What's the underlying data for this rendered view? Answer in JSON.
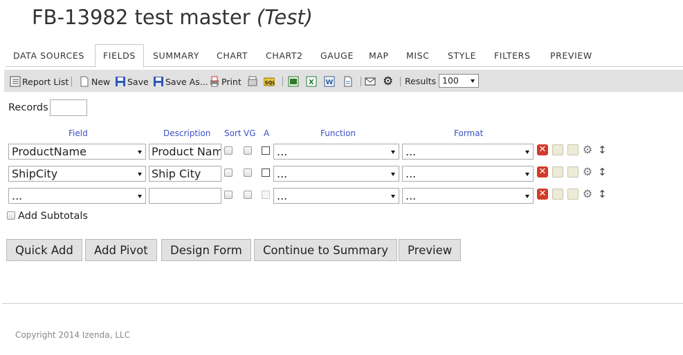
{
  "header": {
    "title": "FB-13982 test master",
    "env": "(Test)"
  },
  "tabs": [
    {
      "label": "DATA SOURCES",
      "active": false
    },
    {
      "label": "FIELDS",
      "active": true
    },
    {
      "label": "SUMMARY",
      "active": false
    },
    {
      "label": "CHART",
      "active": false
    },
    {
      "label": "CHART2",
      "active": false
    },
    {
      "label": "GAUGE",
      "active": false
    },
    {
      "label": "MAP",
      "active": false
    },
    {
      "label": "MISC",
      "active": false
    },
    {
      "label": "STYLE",
      "active": false
    },
    {
      "label": "FILTERS",
      "active": false
    },
    {
      "label": "PREVIEW",
      "active": false
    }
  ],
  "toolbar": {
    "report_list": "Report List",
    "new": "New",
    "save": "Save",
    "save_as": "Save As...",
    "print": "Print",
    "results_label": "Results",
    "results_value": "100",
    "icons": [
      "report-list-icon",
      "new-doc-icon",
      "save-icon",
      "save-as-icon",
      "print-pdf-icon",
      "html-icon",
      "sql-icon",
      "excel-export-icon",
      "excel-icon",
      "word-icon",
      "text-doc-icon",
      "email-icon",
      "gear-icon"
    ]
  },
  "records": {
    "label": "Records",
    "value": ""
  },
  "columns": {
    "field": "Field",
    "description": "Description",
    "sort": "Sort",
    "vg": "VG",
    "a": "A",
    "function": "Function",
    "format": "Format"
  },
  "rows": [
    {
      "field": "ProductName",
      "description": "Product Name",
      "function": "...",
      "format": "..."
    },
    {
      "field": "ShipCity",
      "description": "Ship City",
      "function": "...",
      "format": "..."
    },
    {
      "field": "...",
      "description": "",
      "function": "...",
      "format": "..."
    }
  ],
  "subtotals": {
    "label": "Add Subtotals"
  },
  "buttons": {
    "quick_add": "Quick Add",
    "add_pivot": "Add Pivot",
    "design_form": "Design Form",
    "continue": "Continue to Summary",
    "preview": "Preview"
  },
  "footer": {
    "copyright": "Copyright 2014 Izenda, LLC"
  },
  "colors": {
    "link_blue": "#3b4fc4",
    "toolbar_bg": "#e1e1e1",
    "delete_red": "#d23a2a"
  }
}
